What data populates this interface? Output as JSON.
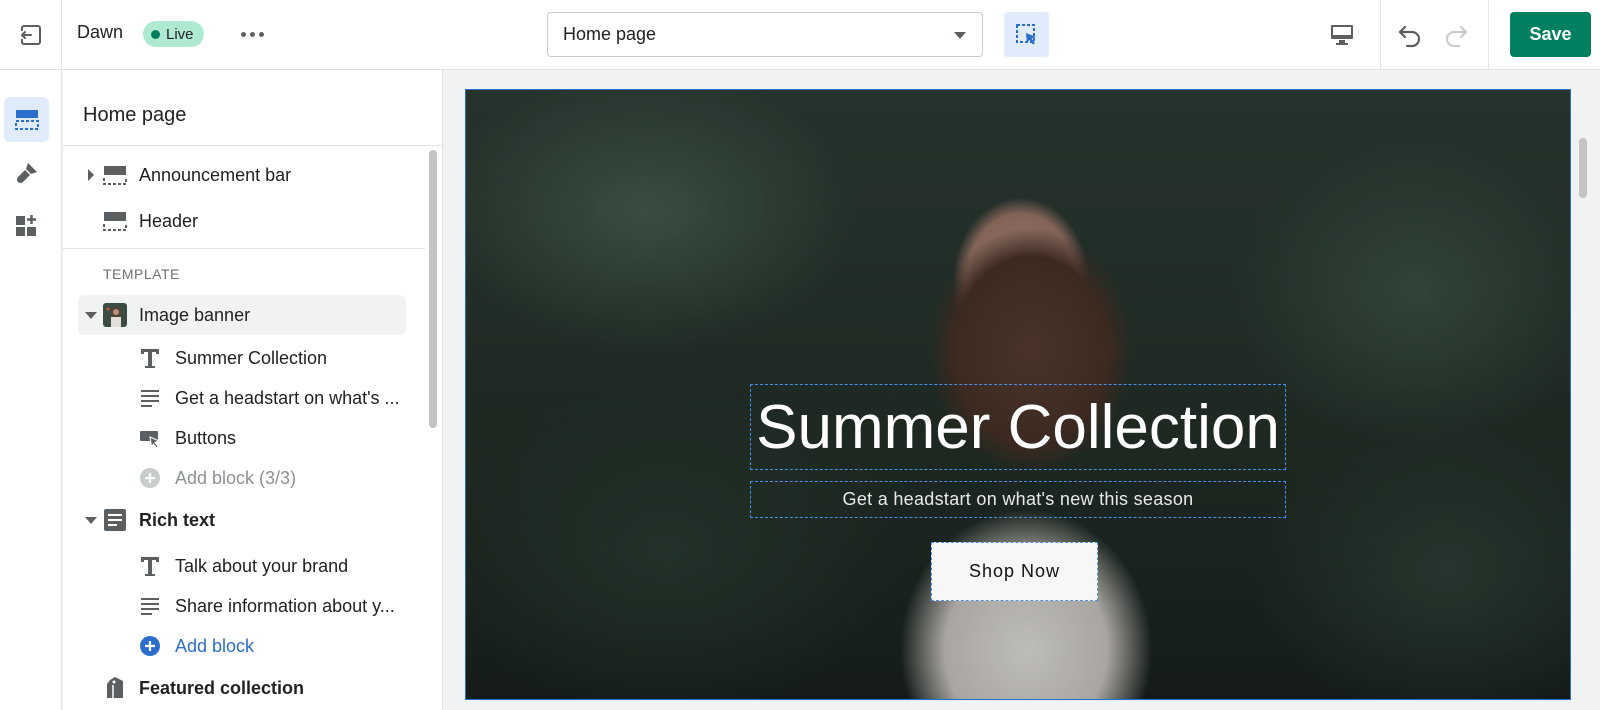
{
  "topbar": {
    "theme_name": "Dawn",
    "status_badge": "Live",
    "page_selector": "Home page",
    "save_label": "Save"
  },
  "sidebar": {
    "title": "Home page",
    "sections_header": [
      {
        "label": "Announcement bar",
        "icon": "section-header-icon",
        "expandable": true
      },
      {
        "label": "Header",
        "icon": "section-header-icon",
        "expandable": false
      }
    ],
    "template_label": "TEMPLATE",
    "image_banner": {
      "label": "Image banner",
      "blocks": [
        {
          "label": "Summer Collection",
          "icon": "heading-icon"
        },
        {
          "label": "Get a headstart on what's ...",
          "icon": "text-icon"
        },
        {
          "label": "Buttons",
          "icon": "button-icon"
        }
      ],
      "add_block": "Add block (3/3)"
    },
    "rich_text": {
      "label": "Rich text",
      "blocks": [
        {
          "label": "Talk about your brand",
          "icon": "heading-icon"
        },
        {
          "label": "Share information about y...",
          "icon": "text-icon"
        }
      ],
      "add_block": "Add block"
    },
    "featured_collection": "Featured collection"
  },
  "preview": {
    "hero_title": "Summer Collection",
    "hero_subtitle": "Get a headstart on what's new this season",
    "hero_button": "Shop Now"
  },
  "colors": {
    "accent": "#2c6ecb",
    "save_green": "#008060",
    "live_badge": "#aee9d1"
  }
}
